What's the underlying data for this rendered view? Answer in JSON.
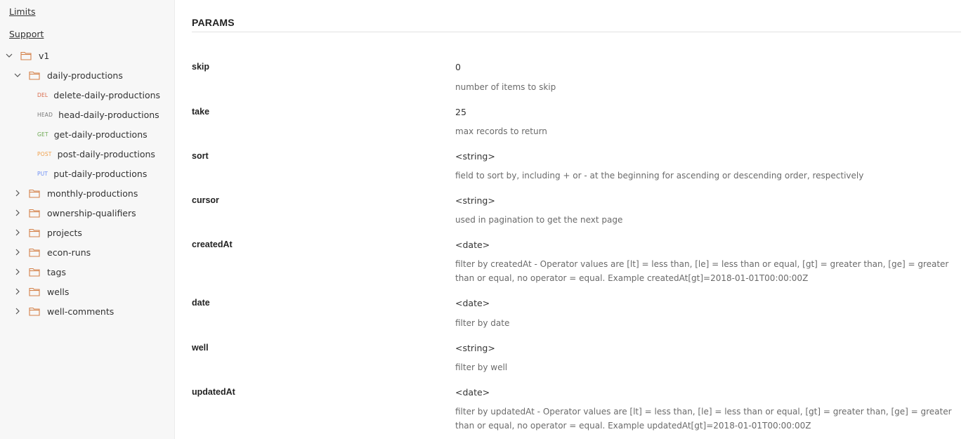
{
  "sidebar": {
    "links": [
      "Limits",
      "Support"
    ],
    "root": {
      "label": "v1",
      "expanded": true
    },
    "daily": {
      "label": "daily-productions",
      "expanded": true,
      "endpoints": [
        {
          "method": "DEL",
          "label": "delete-daily-productions"
        },
        {
          "method": "HEAD",
          "label": "head-daily-productions"
        },
        {
          "method": "GET",
          "label": "get-daily-productions"
        },
        {
          "method": "POST",
          "label": "post-daily-productions"
        },
        {
          "method": "PUT",
          "label": "put-daily-productions"
        }
      ]
    },
    "folders": [
      "monthly-productions",
      "ownership-qualifiers",
      "projects",
      "econ-runs",
      "tags",
      "wells",
      "well-comments"
    ],
    "colors": {
      "folder": "#d4824a",
      "del": "#d9694a",
      "head": "#777777",
      "get": "#6aa84f",
      "post": "#f0a04b",
      "put": "#6c8ef5"
    }
  },
  "main": {
    "section_title": "PARAMS",
    "params": [
      {
        "name": "skip",
        "type": "0",
        "description": "number of items to skip"
      },
      {
        "name": "take",
        "type": "25",
        "description": "max records to return"
      },
      {
        "name": "sort",
        "type": "<string>",
        "description": "field to sort by, including + or - at the beginning for ascending or descending order, respectively"
      },
      {
        "name": "cursor",
        "type": "<string>",
        "description": "used in pagination to get the next page"
      },
      {
        "name": "createdAt",
        "type": "<date>",
        "description": "filter by createdAt - Operator values are [lt] = less than, [le] = less than or equal, [gt] = greater than, [ge] = greater than or equal, no operator = equal. Example createdAt[gt]=2018-01-01T00:00:00Z"
      },
      {
        "name": "date",
        "type": "<date>",
        "description": "filter by date"
      },
      {
        "name": "well",
        "type": "<string>",
        "description": "filter by well"
      },
      {
        "name": "updatedAt",
        "type": "<date>",
        "description": "filter by updatedAt - Operator values are [lt] = less than, [le] = less than or equal, [gt] = greater than, [ge] = greater than or equal, no operator = equal. Example updatedAt[gt]=2018-01-01T00:00:00Z"
      }
    ]
  }
}
